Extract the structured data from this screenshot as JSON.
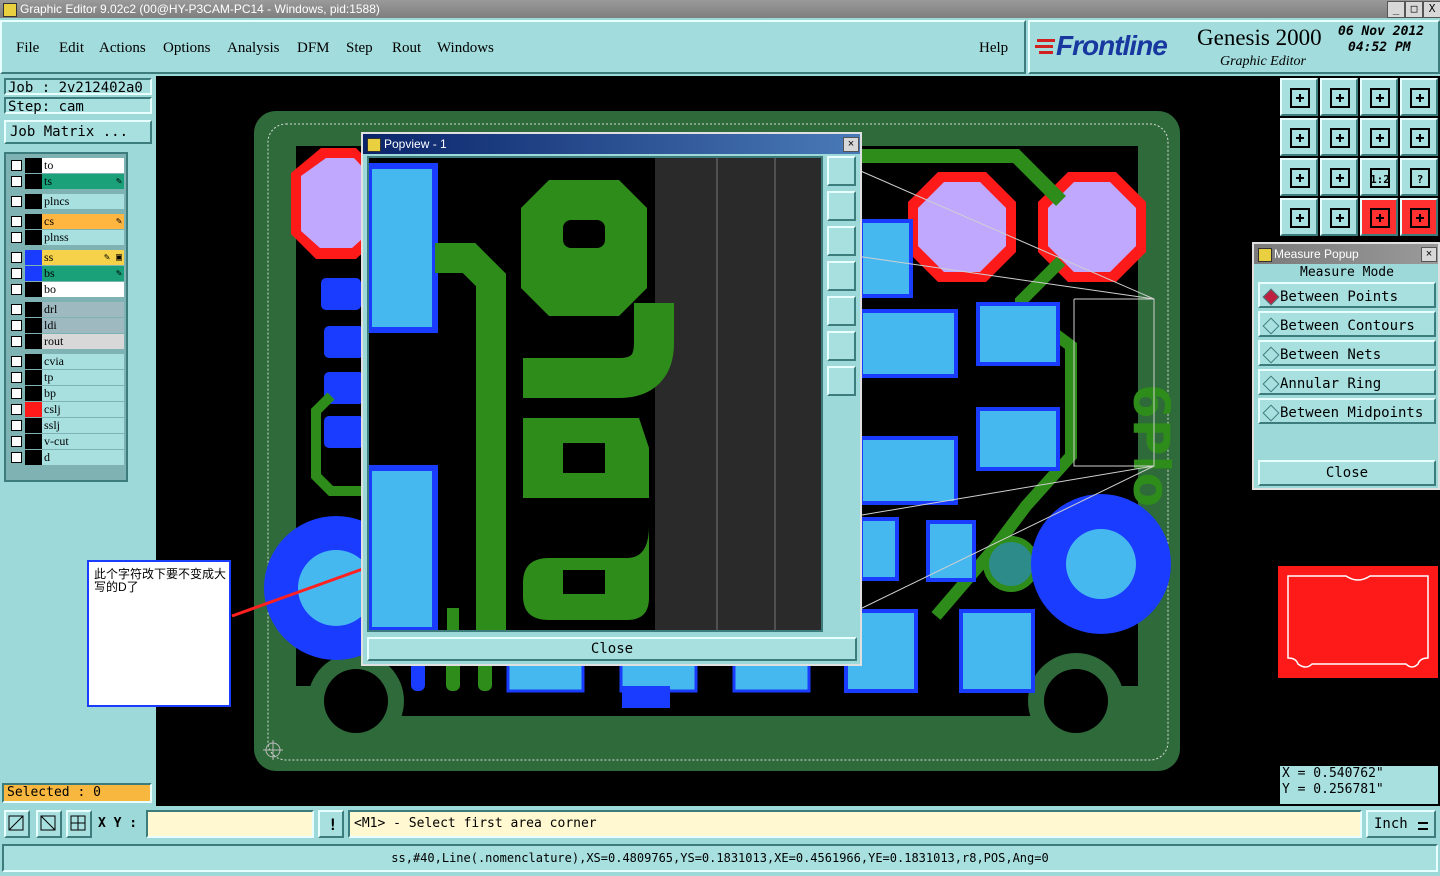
{
  "window": {
    "title": "Graphic Editor 9.02c2 (00@HY-P3CAM-PC14 - Windows, pid:1588)",
    "minimize": "_",
    "maximize": "□",
    "close": "X"
  },
  "menubar": {
    "items": [
      "File",
      "Edit",
      "Actions",
      "Options",
      "Analysis",
      "DFM",
      "Step",
      "Rout",
      "Windows"
    ],
    "help": "Help"
  },
  "brand": {
    "logo": "Frontline",
    "product": "Genesis 2000",
    "subtitle": "Graphic Editor",
    "date": "06 Nov 2012",
    "time": "04:52 PM"
  },
  "job": {
    "job_line": "Job : 2v212402a0",
    "step_line": "Step: cam",
    "matrix_button": "Job Matrix ..."
  },
  "layers": [
    {
      "name": "to",
      "color": "#ffffff",
      "mark": ""
    },
    {
      "name": "ts",
      "color": "#1aa17a",
      "mark": "✎"
    },
    {
      "name": "plncs",
      "color": "#a8e0e0",
      "mark": ""
    },
    {
      "name": "cs",
      "color": "#ffb640",
      "mark": "✎"
    },
    {
      "name": "plnss",
      "color": "#a8e0e0",
      "mark": ""
    },
    {
      "name": "ss",
      "color": "#f5d24a",
      "mark": "✎ ▣"
    },
    {
      "name": "bs",
      "color": "#1aa17a",
      "mark": "✎"
    },
    {
      "name": "bo",
      "color": "#ffffff",
      "mark": ""
    },
    {
      "name": "drl",
      "color": "#9fb9c0",
      "mark": ""
    },
    {
      "name": "ldi",
      "color": "#9fb9c0",
      "mark": ""
    },
    {
      "name": "rout",
      "color": "#d8d8d8",
      "mark": ""
    },
    {
      "name": "cvia",
      "color": "#a8e0e0",
      "mark": ""
    },
    {
      "name": "tp",
      "color": "#a8e0e0",
      "mark": ""
    },
    {
      "name": "bp",
      "color": "#a8e0e0",
      "mark": ""
    },
    {
      "name": "cslj",
      "color": "#a8e0e0",
      "mark": ""
    },
    {
      "name": "sslj",
      "color": "#a8e0e0",
      "mark": ""
    },
    {
      "name": "v-cut",
      "color": "#a8e0e0",
      "mark": ""
    },
    {
      "name": "d",
      "color": "#a8e0e0",
      "mark": ""
    }
  ],
  "selected": "Selected : 0",
  "popview": {
    "title": "Popview - 1",
    "close_button": "Close"
  },
  "annotation": {
    "note_text": "此个字符改下要不变成大写的D了"
  },
  "measure": {
    "title": "Measure Popup",
    "mode_label": "Measure Mode",
    "options": [
      "Between Points",
      "Between Contours",
      "Between Nets",
      "Annular Ring",
      "Between Midpoints"
    ],
    "selected_option": "Between Points",
    "close_button": "Close"
  },
  "toolbar_icons": [
    "zoom-home-icon",
    "zoom-in-icon",
    "home-icon",
    "fit-icon",
    "pan-left-icon",
    "pan-right-icon",
    "undo-zoom-icon",
    "redraw-icon",
    "fit-window-icon",
    "center-icon",
    "ratio-icon",
    "help-icon",
    "measure-icon",
    "grid-icon",
    "snap-icon",
    "snap-alt-icon"
  ],
  "toolbar_texts": {
    "ratio": "1:2",
    "help": "?"
  },
  "coords": {
    "x": "X = 0.540762\"",
    "y": "Y = 0.256781\""
  },
  "command": {
    "xy_label": "X Y :",
    "input_value": "",
    "prompt": "<M1> - Select first area corner",
    "units": "Inch",
    "status_line": "ss,#40,Line(.nomenclature),XS=0.4809765,YS=0.1831013,XE=0.4561966,YE=0.1831013,r8,POS,Ang=0"
  }
}
